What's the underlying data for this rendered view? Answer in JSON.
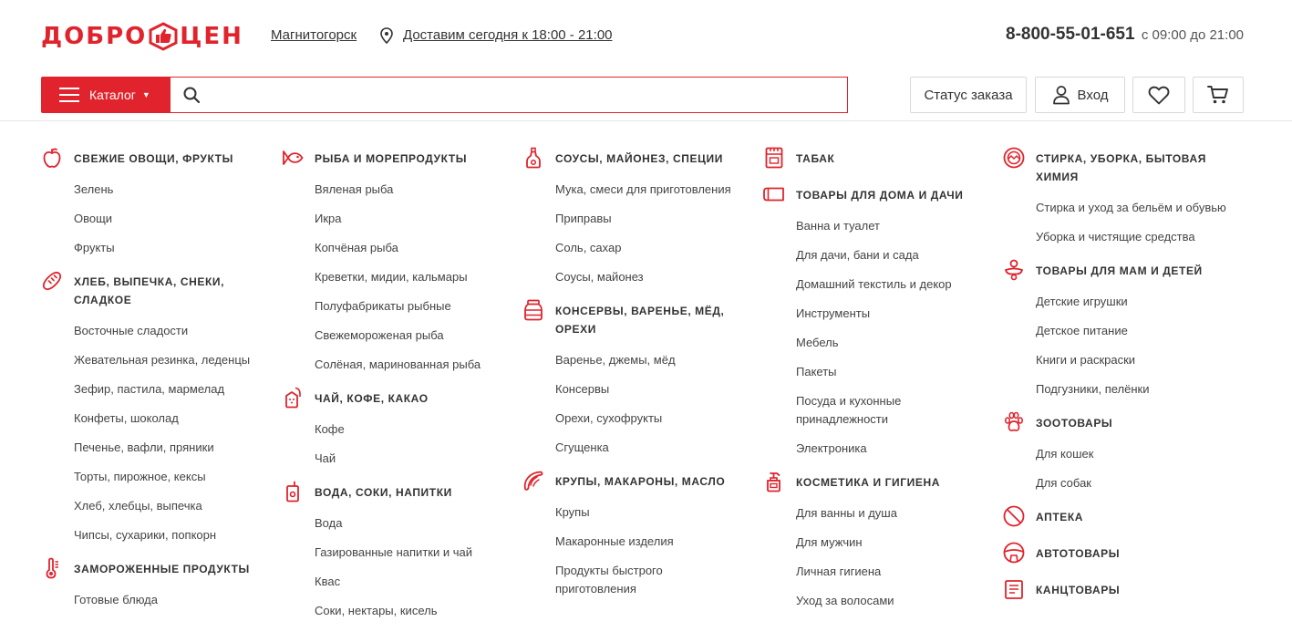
{
  "header": {
    "logo_left": "ДОБРО",
    "logo_right": "ЦЕН",
    "city": "Магнитогорск",
    "delivery": "Доставим сегодня к 18:00 - 21:00",
    "phone": "8-800-55-01-651",
    "phone_hours": "с 09:00 до 21:00",
    "catalog_label": "Каталог",
    "search_placeholder": "",
    "order_status_label": "Статус заказа",
    "login_label": "Вход",
    "accent_color": "#e0232c"
  },
  "columns": [
    {
      "categories": [
        {
          "title": "Свежие овощи, фрукты",
          "icon": "apple-icon",
          "items": [
            "Зелень",
            "Овощи",
            "Фрукты"
          ]
        },
        {
          "title": "Хлеб, выпечка, снеки, сладкое",
          "icon": "baguette-icon",
          "items": [
            "Восточные сладости",
            "Жевательная резинка, леденцы",
            "Зефир, пастила, мармелад",
            "Конфеты, шоколад",
            "Печенье, вафли, пряники",
            "Торты, пирожное, кексы",
            "Хлеб, хлебцы, выпечка",
            "Чипсы, сухарики, попкорн"
          ]
        },
        {
          "title": "Замороженные продукты",
          "icon": "thermometer-icon",
          "items": [
            "Готовые блюда"
          ]
        }
      ]
    },
    {
      "categories": [
        {
          "title": "Рыба и морепродукты",
          "icon": "fish-icon",
          "items": [
            "Вяленая рыба",
            "Икра",
            "Копчёная рыба",
            "Креветки, мидии, кальмары",
            "Полуфабрикаты рыбные",
            "Свежемороженая рыба",
            "Солёная, маринованная рыба"
          ]
        },
        {
          "title": "Чай, кофе, какао",
          "icon": "tea-bag-icon",
          "items": [
            "Кофе",
            "Чай"
          ]
        },
        {
          "title": "Вода, соки, напитки",
          "icon": "juice-icon",
          "items": [
            "Вода",
            "Газированные напитки и чай",
            "Квас",
            "Соки, нектары, кисель"
          ]
        }
      ]
    },
    {
      "categories": [
        {
          "title": "Соусы, майонез, специи",
          "icon": "sauce-bottle-icon",
          "items": [
            "Мука, смеси для приготовления",
            "Приправы",
            "Соль, сахар",
            "Соусы, майонез"
          ]
        },
        {
          "title": "Консервы, варенье, мёд, орехи",
          "icon": "jar-icon",
          "items": [
            "Варенье, джемы, мёд",
            "Консервы",
            "Орехи, сухофрукты",
            "Сгущенка"
          ]
        },
        {
          "title": "Крупы, макароны, масло",
          "icon": "pasta-icon",
          "items": [
            "Крупы",
            "Макаронные изделия",
            "Продукты быстрого приготовления"
          ]
        }
      ]
    },
    {
      "categories": [
        {
          "title": "Табак",
          "icon": "cigarette-pack-icon",
          "items": []
        },
        {
          "title": "Товары для дома и дачи",
          "icon": "towel-icon",
          "items": [
            "Ванна и туалет",
            "Для дачи, бани и сада",
            "Домашний текстиль и декор",
            "Инструменты",
            "Мебель",
            "Пакеты",
            "Посуда и кухонные принадлежности",
            "Электроника"
          ]
        },
        {
          "title": "Косметика и гигиена",
          "icon": "soap-dispenser-icon",
          "items": [
            "Для ванны и душа",
            "Для мужчин",
            "Личная гигиена",
            "Уход за волосами"
          ]
        }
      ]
    },
    {
      "categories": [
        {
          "title": "Стирка, уборка, бытовая химия",
          "icon": "washing-machine-icon",
          "items": [
            "Стирка и уход за бельём и обувью",
            "Уборка и чистящие средства"
          ]
        },
        {
          "title": "Товары для мам и детей",
          "icon": "pacifier-icon",
          "items": [
            "Детские игрушки",
            "Детское питание",
            "Книги и раскраски",
            "Подгузники, пелёнки"
          ]
        },
        {
          "title": "Зоотовары",
          "icon": "paw-icon",
          "items": [
            "Для кошек",
            "Для собак"
          ]
        },
        {
          "title": "Аптека",
          "icon": "pill-icon",
          "items": []
        },
        {
          "title": "Автотовары",
          "icon": "steering-wheel-icon",
          "items": []
        },
        {
          "title": "Канцтовары",
          "icon": "stationery-icon",
          "items": []
        }
      ]
    }
  ]
}
